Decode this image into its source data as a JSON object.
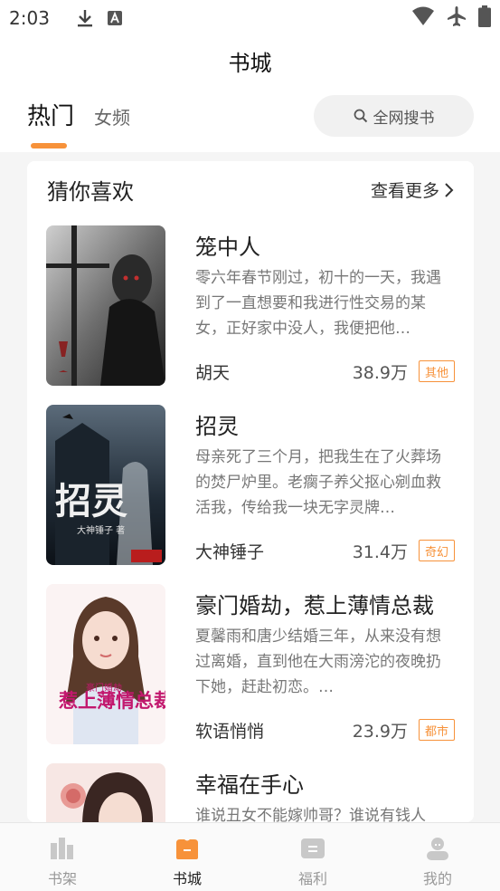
{
  "status_bar": {
    "time": "2:03"
  },
  "header": {
    "title": "书城"
  },
  "tabs": {
    "hot": "热门",
    "female": "女频",
    "search_placeholder": "全网搜书"
  },
  "section": {
    "title": "猜你喜欢",
    "more_label": "查看更多"
  },
  "books": [
    {
      "title": "笼中人",
      "description": "零六年春节刚过，初十的一天，我遇到了一直想要和我进行性交易的某女，正好家中没人，我便把他…",
      "author": "胡天",
      "count": "38.9万",
      "tag": "其他"
    },
    {
      "title": "招灵",
      "description": "母亲死了三个月，把我生在了火葬场的焚尸炉里。老瘸子养父抠心剜血救活我，传给我一块无字灵牌…",
      "author": "大神锤子",
      "count": "31.4万",
      "tag": "奇幻",
      "cover_text": "招灵",
      "cover_author": "大神锤子 著"
    },
    {
      "title": "豪门婚劫，惹上薄情总裁",
      "description": "夏馨雨和唐少结婚三年，从来没有想过离婚，直到他在大雨滂沱的夜晚扔下她，赶赴初恋。…",
      "author": "软语悄悄",
      "count": "23.9万",
      "tag": "都市",
      "cover_text": "惹上薄情总裁",
      "cover_sub": "豪门婚劫"
    },
    {
      "title": "幸福在手心",
      "description": "谁说丑女不能嫁帅哥？谁说有钱人"
    }
  ],
  "bottom_nav": [
    {
      "label": "书架",
      "icon": "bookshelf-icon",
      "active": false
    },
    {
      "label": "书城",
      "icon": "bookstore-icon",
      "active": true
    },
    {
      "label": "福利",
      "icon": "welfare-icon",
      "active": false
    },
    {
      "label": "我的",
      "icon": "profile-icon",
      "active": false
    }
  ],
  "colors": {
    "accent": "#f7923a",
    "inactive_icon": "#c8c8c8"
  }
}
